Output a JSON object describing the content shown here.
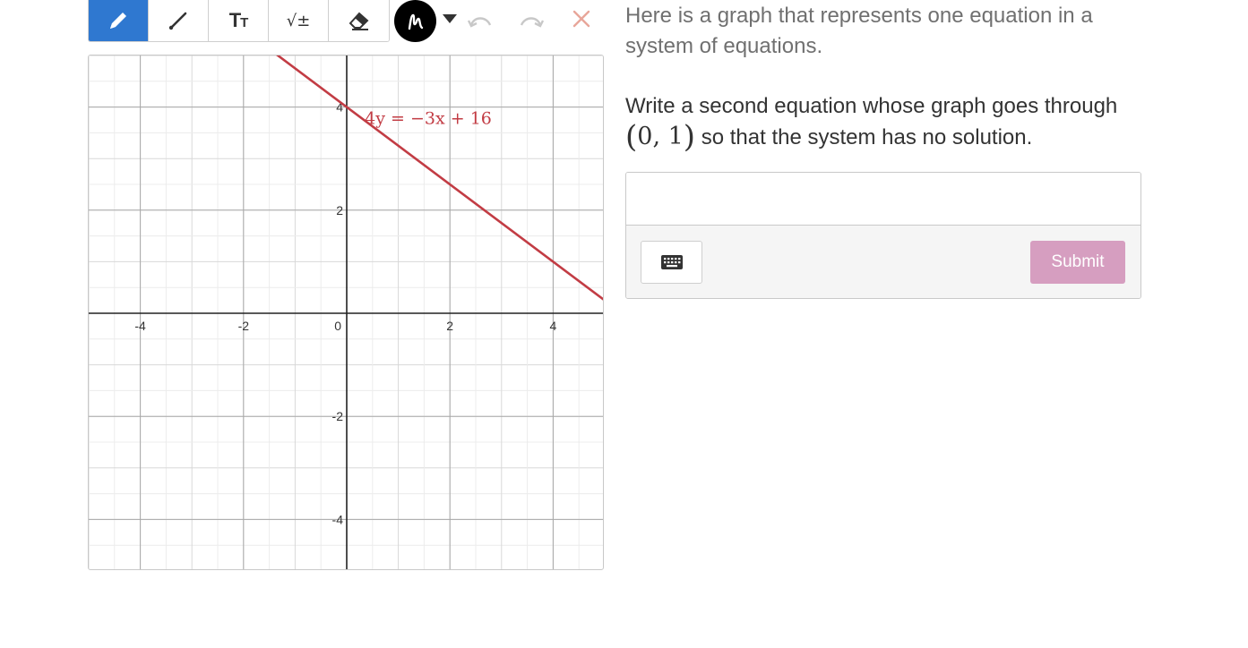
{
  "toolbar": {
    "tools": [
      {
        "name": "pencil-icon",
        "active": true
      },
      {
        "name": "line-icon",
        "active": false
      },
      {
        "name": "text-icon",
        "label": "TT",
        "active": false
      },
      {
        "name": "math-icon",
        "label": "√±",
        "active": false
      },
      {
        "name": "eraser-icon",
        "active": false
      }
    ],
    "color_icon": "scribble-icon",
    "undo_icon": "undo-icon",
    "redo_icon": "redo-icon",
    "close_icon": "close-icon",
    "close_color": "#e8a69a"
  },
  "graph": {
    "x_range": [
      -5,
      5
    ],
    "y_range": [
      -5,
      5
    ],
    "x_ticks": [
      "-4",
      "-2",
      "0",
      "2",
      "4"
    ],
    "y_ticks": [
      "4",
      "2",
      "-2",
      "-4"
    ],
    "line": {
      "slope": -0.75,
      "intercept": 4,
      "color": "#c23c44"
    },
    "equation_label": "4y = −3x + 16"
  },
  "prompt": {
    "line1": "Here is a graph that represents one equation in a system of equations.",
    "line2_a": "Write a second equation whose graph goes through",
    "point": "0, 1",
    "line2_b": "so that the system has no solution."
  },
  "answer": {
    "value": "",
    "placeholder": "",
    "keyboard_icon": "keyboard-icon",
    "submit_label": "Submit",
    "submit_color": "#d69ec0"
  }
}
